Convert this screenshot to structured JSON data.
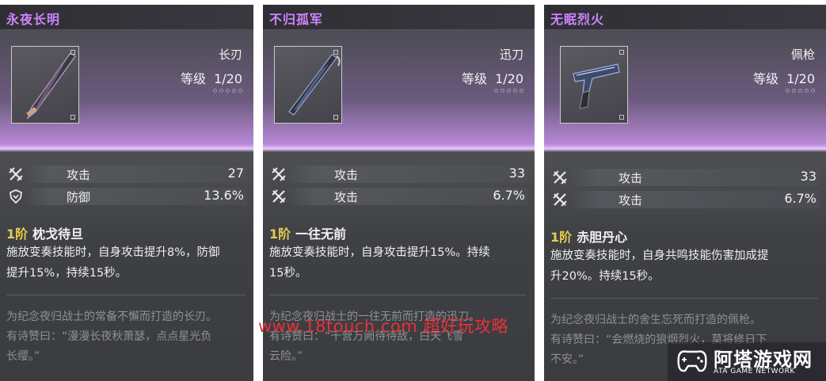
{
  "cards": [
    {
      "title": "永夜长明",
      "weapon_type": "长刃",
      "level_label": "等级",
      "level_value": "1/20",
      "stats": [
        {
          "icon": "attack-icon",
          "label": "攻击",
          "value": "27"
        },
        {
          "icon": "defense-icon",
          "label": "防御",
          "value": "13.6%"
        }
      ],
      "skill_tier": "1阶",
      "skill_name": "枕戈待旦",
      "skill_desc_lines": [
        "施放变奏技能时，自身攻击提升8%，防御",
        "提升15%，持续15秒。"
      ],
      "lore_lines": [
        "为纪念夜归战士的常备不懈而打造的长刃。",
        "有诗赞曰：“漫漫长夜秋萧瑟，点点星光负",
        "长缨。”"
      ]
    },
    {
      "title": "不归孤军",
      "weapon_type": "迅刀",
      "level_label": "等级",
      "level_value": "1/20",
      "stats": [
        {
          "icon": "attack-icon",
          "label": "攻击",
          "value": "33"
        },
        {
          "icon": "attack-icon",
          "label": "攻击",
          "value": "6.7%"
        }
      ],
      "skill_tier": "1阶",
      "skill_name": "一往无前",
      "skill_desc_lines": [
        "施放变奏技能时，自身攻击提升15%。持续",
        "15秒。"
      ],
      "lore_lines": [
        "为纪念夜归战士的一往无前而打造的迅刀。",
        "有诗赞曰：“千营万阙待待敌，白天飞雪",
        "云险。”"
      ]
    },
    {
      "title": "无眠烈火",
      "weapon_type": "佩枪",
      "level_label": "等级",
      "level_value": "1/20",
      "stats": [
        {
          "icon": "attack-icon",
          "label": "攻击",
          "value": "33"
        },
        {
          "icon": "attack-icon",
          "label": "攻击",
          "value": "6.7%"
        }
      ],
      "skill_tier": "1阶",
      "skill_name": "赤胆丹心",
      "skill_desc_lines": [
        "施放变奏技能时，自身共鸣技能伤害加成提",
        "升20%。持续15秒。"
      ],
      "lore_lines": [
        "为纪念夜归战士的舍生忘死而打造的佩枪。",
        "有诗赞曰：“会燃烧的狼烟烈火，莫将修日下",
        "不安。”"
      ]
    }
  ],
  "watermark": "www.18touch.com 超好玩攻略",
  "logo": {
    "name": "阿塔游戏网",
    "sub": "ATA GAME NETWORK"
  },
  "colors": {
    "title": "#cf84ff",
    "tier": "#e6cd4f",
    "accent_glow": "#e9c8fb",
    "watermark": "#e8323a"
  }
}
